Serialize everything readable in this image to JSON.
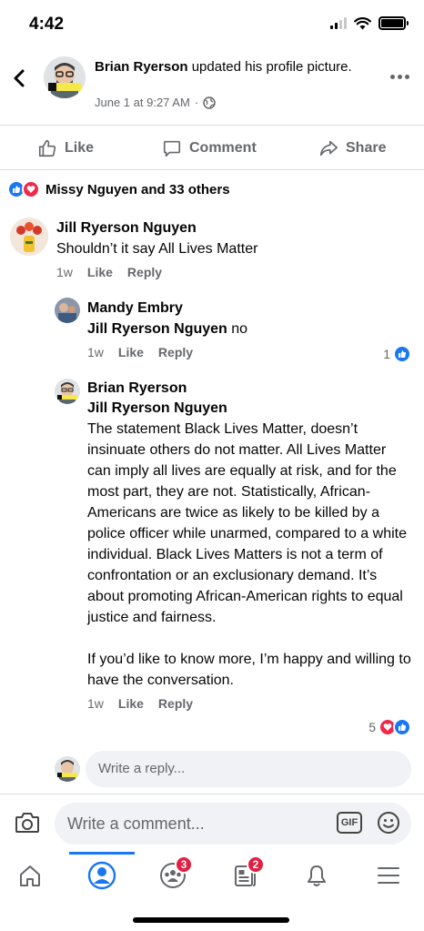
{
  "status_bar": {
    "time": "4:42"
  },
  "post": {
    "author": "Brian Ryerson",
    "action_text": "updated his profile picture.",
    "timestamp": "June 1 at 9:27 AM",
    "separator": "·"
  },
  "actions": {
    "like": "Like",
    "comment": "Comment",
    "share": "Share"
  },
  "reactions": {
    "summary": "Missy Nguyen and 33 others"
  },
  "comments": [
    {
      "author": "Jill Ryerson Nguyen",
      "text": "Shouldn’t it say All Lives Matter",
      "time": "1w",
      "like": "Like",
      "reply": "Reply"
    }
  ],
  "replies": [
    {
      "author": "Mandy Embry",
      "mention": "Jill Ryerson Nguyen",
      "text": " no",
      "time": "1w",
      "like": "Like",
      "reply": "Reply",
      "reaction_count": "1"
    },
    {
      "author": "Brian Ryerson",
      "mention": "Jill Ryerson Nguyen",
      "paragraph1": "The statement Black Lives Matter, doesn’t insinuate others do not matter. All Lives Matter can imply all lives are equally at risk, and for the most part, they are not. Statistically, African-Americans are twice as likely to be killed by a police officer while unarmed, compared to a white individual. Black Lives Matters is not a term of confrontation or an exclusionary demand. It’s about promoting African-American rights to equal justice and fairness.",
      "paragraph2": "If you’d like to know more, I’m happy and willing to have the conversation.",
      "time": "1w",
      "like": "Like",
      "reply": "Reply",
      "reaction_count": "5"
    }
  ],
  "reply_box": {
    "placeholder": "Write a reply..."
  },
  "composer": {
    "placeholder": "Write a comment...",
    "gif": "GIF"
  },
  "tabs": {
    "groups_badge": "3",
    "news_badge": "2"
  },
  "colors": {
    "accent": "#1877f2",
    "love": "#f02849",
    "badge": "#e41e3f",
    "secondary_text": "#65676b"
  },
  "icons": [
    "back-icon",
    "more-icon",
    "like-icon",
    "comment-icon",
    "share-icon",
    "globe-icon",
    "camera-icon",
    "gif-icon",
    "emoji-icon",
    "home-icon",
    "profile-icon",
    "groups-icon",
    "news-icon",
    "bell-icon",
    "menu-icon"
  ]
}
